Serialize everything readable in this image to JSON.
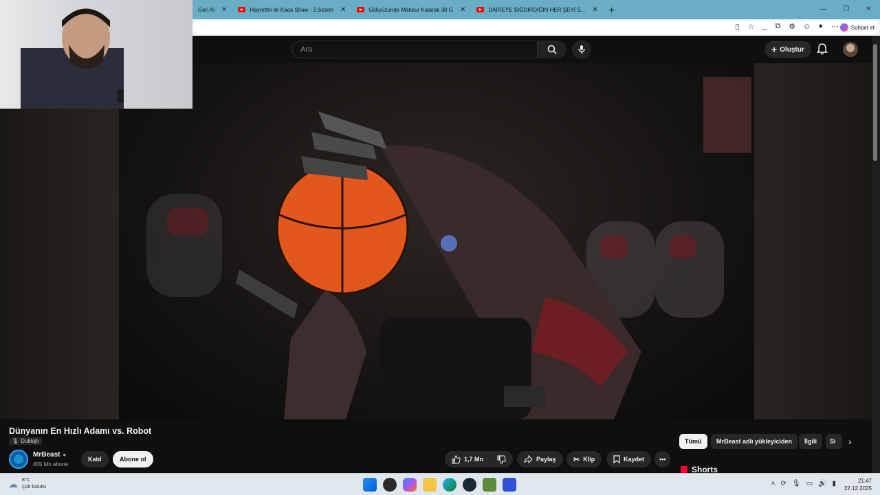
{
  "browser": {
    "tabs": [
      {
        "label": "Geri Al"
      },
      {
        "label": "Hayrettin ile Kaos Show - 2.Sezon"
      },
      {
        "label": "Gökyüzünde Mahsur Kalarak 30 G"
      },
      {
        "label": "DAIREYE SIĞDIRDIĞIN HER ŞEYİ S..."
      }
    ],
    "new_tab": "+",
    "copilot_label": "Sohbet et"
  },
  "youtube": {
    "search_placeholder": "Ara",
    "create_label": "Oluştur"
  },
  "video": {
    "title": "Dünyanın En Hızlı Adamı vs. Robot",
    "dub_label": "Dublajlı",
    "channel_name": "MrBeast",
    "subscribers": "455 Mn abone",
    "join_label": "Katıl",
    "subscribe_label": "Abone ol",
    "like_count": "1,7 Mn",
    "share_label": "Paylaş",
    "clip_label": "Klip",
    "save_label": "Kaydet",
    "more_label": "•••"
  },
  "chips": [
    {
      "label": "Tümü",
      "active": true
    },
    {
      "label": "MrBeast adlı yükleyiciden",
      "active": false
    },
    {
      "label": "İlgili",
      "active": false
    },
    {
      "label": "Si",
      "active": false
    }
  ],
  "shorts_label": "Shorts",
  "taskbar": {
    "temperature": "8°C",
    "weather": "Çok bulutlu",
    "time": "21:47",
    "date": "22.12.2025"
  },
  "colors": {
    "youtube_red": "#ff0000",
    "browser_tabstrip": "#6aaec6",
    "page_bg": "#0f0f0f"
  }
}
